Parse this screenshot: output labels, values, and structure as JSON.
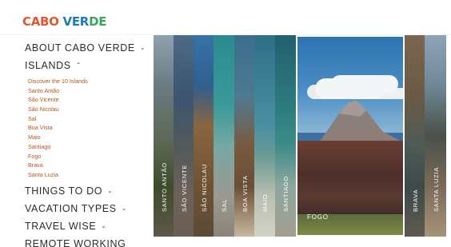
{
  "header": {
    "logo": {
      "part1": "CABO",
      "part2": " ",
      "part3": "VER",
      "part4": "DE"
    }
  },
  "sidebar": {
    "items": [
      {
        "label": "ABOUT CABO VERDE",
        "chevron": "⌄"
      },
      {
        "label": "ISLANDS",
        "chevron": "⌃"
      },
      {
        "label": "THINGS TO DO",
        "chevron": "⌄"
      },
      {
        "label": "VACATION TYPES",
        "chevron": "⌄"
      },
      {
        "label": "TRAVEL WISE",
        "chevron": "⌄"
      },
      {
        "label": "REMOTE WORKING",
        "chevron": ""
      }
    ],
    "islands_submenu": [
      "Discover the 10 Islands",
      "Santo Antão",
      "São Vicente",
      "São Nicolau",
      "Sal",
      "Boa Vista",
      "Maio",
      "Santiago",
      "Fogo",
      "Brava",
      "Santa Luzia"
    ]
  },
  "gallery": {
    "panels": [
      "SANTO ANTÃO",
      "SÃO VICENTE",
      "SÃO NICOLAU",
      "SAL",
      "BOA VISTA",
      "MAIO",
      "SANTIAGO",
      "FOGO",
      "BRAVA",
      "SANTA LUZIA"
    ],
    "active_panel": "FOGO"
  },
  "colors": {
    "submenu_text": "#b3561e",
    "nav_text": "#2c2c2c",
    "logo_red": "#e4572e",
    "logo_yellow": "#f5b700",
    "logo_blue": "#1f7ab8",
    "logo_green": "#3aa55c"
  }
}
